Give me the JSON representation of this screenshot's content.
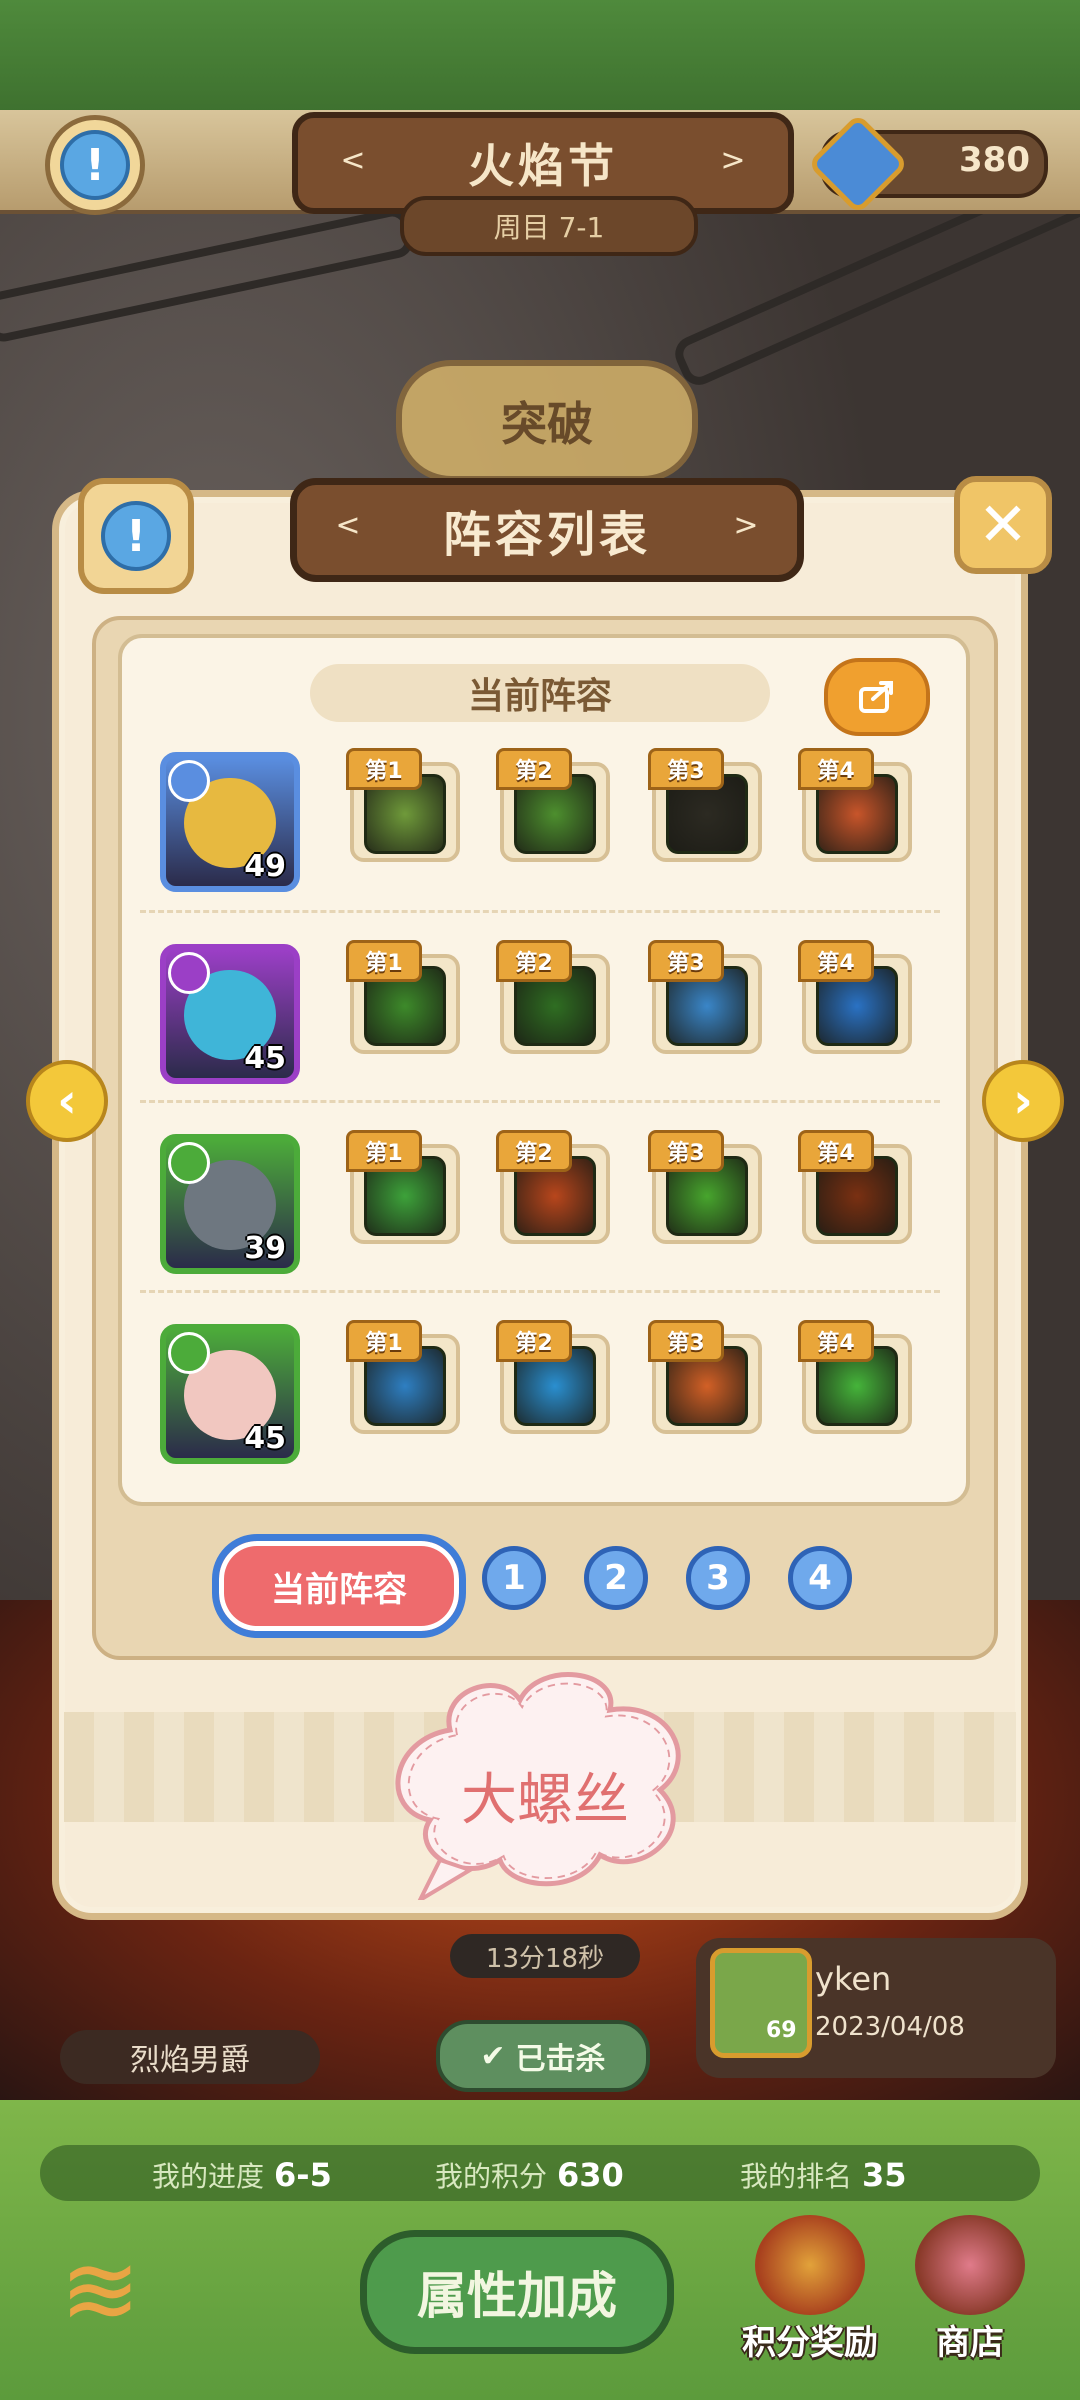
{
  "header": {
    "title": "火焰节",
    "subtitle": "周目 7-1",
    "currency_value": "380",
    "breakthrough_label": "突破"
  },
  "modal": {
    "title": "阵容列表",
    "card_title": "当前阵容",
    "close_icon": "close-icon",
    "info_icon": "info-icon",
    "share_icon": "share-icon",
    "lineup": [
      {
        "hero_level": "49",
        "hero_color": "#5a8ee0",
        "skills": [
          "第1",
          "第2",
          "第3",
          "第4"
        ],
        "skill_colors": [
          "#6f9a3a",
          "#4d8f2e",
          "#2c2a22",
          "#c8552a"
        ]
      },
      {
        "hero_level": "45",
        "hero_color": "#9b3fc6",
        "skills": [
          "第1",
          "第2",
          "第3",
          "第4"
        ],
        "skill_colors": [
          "#3d8a2a",
          "#2f6e22",
          "#3a86c8",
          "#2a72c4"
        ]
      },
      {
        "hero_level": "39",
        "hero_color": "#4cab3a",
        "skills": [
          "第1",
          "第2",
          "第3",
          "第4"
        ],
        "skill_colors": [
          "#3da23a",
          "#b8461c",
          "#47a52d",
          "#7a3012"
        ]
      },
      {
        "hero_level": "45",
        "hero_color": "#4cab3a",
        "skills": [
          "第1",
          "第2",
          "第3",
          "第4"
        ],
        "skill_colors": [
          "#2e7fc2",
          "#2a8fd0",
          "#d26026",
          "#45b43a"
        ]
      }
    ],
    "tabs": {
      "current": "当前阵容",
      "numbers": [
        "1",
        "2",
        "3",
        "4"
      ]
    },
    "bubble_text": "大螺丝"
  },
  "background_info": {
    "timer": "13分18秒",
    "boss_name": "烈焰男爵",
    "killed_label": "已击杀",
    "record_name": "yken",
    "record_date": "2023/04/08",
    "record_level": "69"
  },
  "bottom": {
    "progress_label": "我的进度",
    "progress_value": "6-5",
    "score_label": "我的积分",
    "score_value": "630",
    "rank_label": "我的排名",
    "rank_value": "35",
    "attr_button": "属性加成",
    "reward_button": "积分奖励",
    "shop_button": "商店"
  },
  "colors": {
    "accent_brown": "#7a4e2e",
    "tab_active": "#ee6b6d",
    "tab_number": "#6fa9ec",
    "skill_tag": "#e9a63a"
  }
}
